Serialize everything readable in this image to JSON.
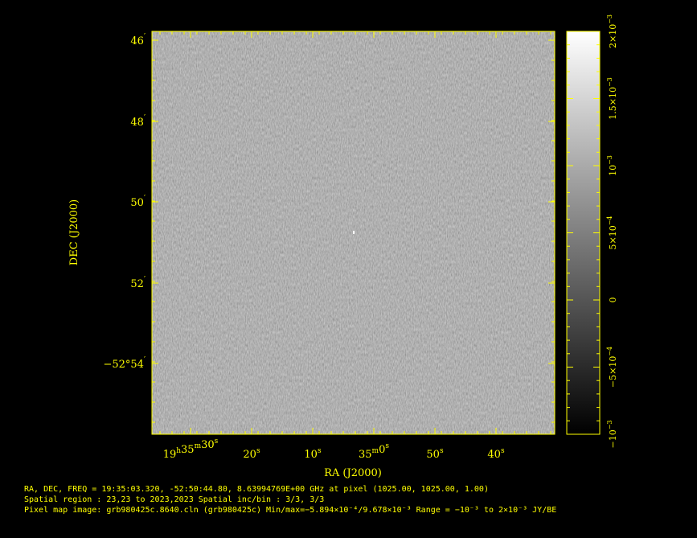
{
  "colors": {
    "background": "#000000",
    "axis": "#ffff00",
    "noise_mid": "#6b6b6b"
  },
  "chart_data": {
    "type": "heatmap",
    "colormap": "grayscale",
    "xlabel": "RA (J2000)",
    "ylabel": "DEC (J2000)",
    "x_ticks": [
      {
        "label_main": "19",
        "sup1": "h",
        "mid": "35",
        "sup2": "m",
        "tail": "30",
        "sup3": "s"
      },
      {
        "label_main": "20",
        "sup1": "s"
      },
      {
        "label_main": "10",
        "sup1": "s"
      },
      {
        "label_main": "35",
        "sup1": "m",
        "tail": "0",
        "sup3": "s"
      },
      {
        "label_main": "50",
        "sup1": "s"
      },
      {
        "label_main": "40",
        "sup1": "s"
      }
    ],
    "y_ticks": [
      "46",
      "48",
      "50",
      "52",
      "−52°54"
    ],
    "y_tick_suffix": "′",
    "colorbar": {
      "min": -0.001,
      "max": 0.002,
      "ticks": [
        {
          "value": -0.001,
          "label": "−10",
          "exp": "−3"
        },
        {
          "value": -0.0005,
          "label": "−5×10",
          "exp": "−4"
        },
        {
          "value": 0,
          "label": "0",
          "exp": ""
        },
        {
          "value": 0.0005,
          "label": "5×10",
          "exp": "−4"
        },
        {
          "value": 0.001,
          "label": "10",
          "exp": "−3"
        },
        {
          "value": 0.0015,
          "label": "1.5×10",
          "exp": "−3"
        },
        {
          "value": 0.002,
          "label": "2×10",
          "exp": "−3"
        }
      ]
    },
    "source_point": {
      "ra": "19:35:03.320",
      "dec": "-52:50:44.80"
    }
  },
  "info": {
    "line1": "RA, DEC, FREQ = 19:35:03.320, -52:50:44.80, 8.63994769E+00 GHz at pixel (1025.00, 1025.00, 1.00)",
    "line2": "Spatial region : 23,23 to 2023,2023 Spatial inc/bin : 3/3, 3/3",
    "line3": "Pixel map image: grb980425c.8640.cln (grb980425c)  Min/max=−5.894×10⁻⁴/9.678×10⁻³  Range = −10⁻³ to 2×10⁻³ JY/BE"
  }
}
